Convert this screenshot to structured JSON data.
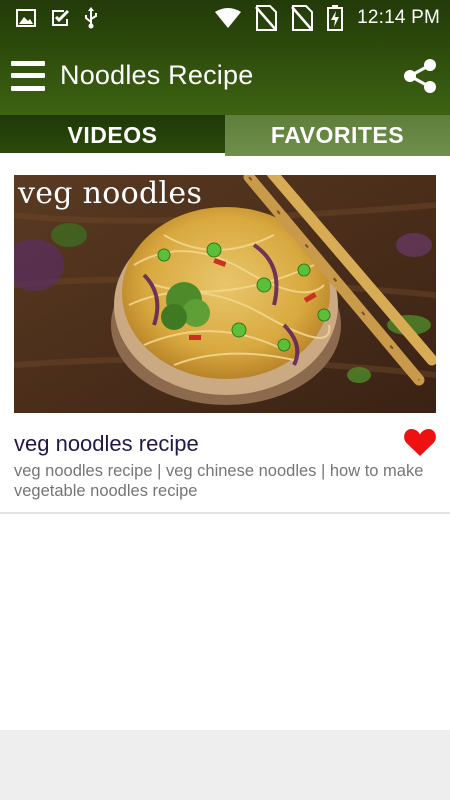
{
  "status_bar": {
    "time": "12:14 PM",
    "icons": [
      "image-icon",
      "checkbox-icon",
      "usb-icon",
      "wifi-icon",
      "no-sim-icon",
      "no-sim-icon",
      "battery-charging-icon"
    ]
  },
  "app_bar": {
    "title": "Noodles Recipe",
    "menu_icon": "hamburger-menu-icon",
    "share_icon": "share-icon"
  },
  "tabs": [
    {
      "label": "VIDEOS",
      "active": true
    },
    {
      "label": "FAVORITES",
      "active": false
    }
  ],
  "videos": [
    {
      "thumbnail_caption": "veg noodles",
      "title": "veg noodles recipe",
      "description": "veg noodles recipe | veg chinese noodles | how to make vegetable noodles recipe",
      "favorite": true
    }
  ],
  "colors": {
    "app_bar": "#2e4c0c",
    "tab_active": "#2d4c0b",
    "tab_inactive": "#6f8f4c",
    "favorite_heart": "#ee1111",
    "title_text": "#1f1a45",
    "description_text": "#757575"
  }
}
